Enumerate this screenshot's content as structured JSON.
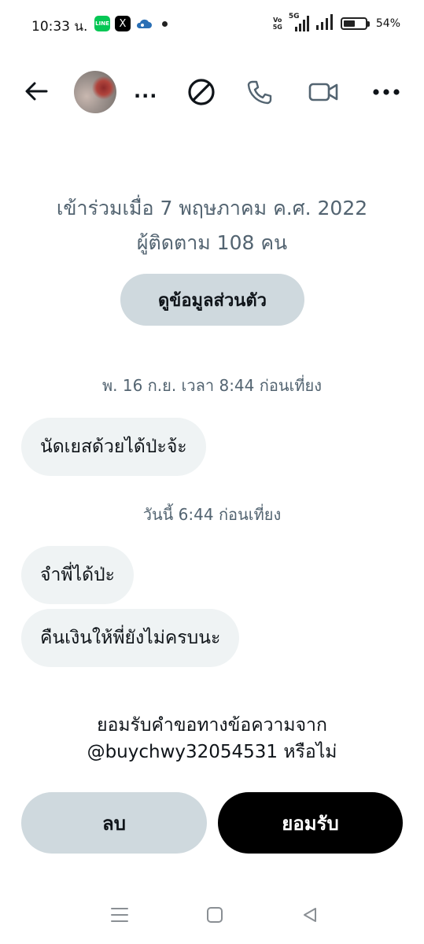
{
  "status_bar": {
    "time": "10:33 น.",
    "battery_percent": "54%",
    "battery_level": 0.54,
    "network": "5G",
    "volte": [
      "Vo",
      "5G"
    ],
    "apps": [
      "LINE",
      "X"
    ]
  },
  "header": {
    "name": "...",
    "icons": [
      "back-arrow-icon",
      "block-icon",
      "phone-icon",
      "video-icon",
      "more-icon"
    ]
  },
  "profile": {
    "joined": "เข้าร่วมเมื่อ 7 พฤษภาคม ค.ศ. 2022",
    "followers": "ผู้ติดตาม 108 คน",
    "view_profile_label": "ดูข้อมูลส่วนตัว"
  },
  "messages": {
    "timestamp_1": "พ. 16 ก.ย. เวลา 8:44 ก่อนเที่ยง",
    "message_1": "นัดเยสด้วยได้ป่ะจ้ะ",
    "timestamp_2": "วันนี้ 6:44 ก่อนเที่ยง",
    "message_2": "จำพี่ได้ป่ะ",
    "message_3": "คืนเงินให้พี่ยังไม่ครบนะ"
  },
  "request": {
    "prompt_line1": "ยอมรับคำขอทางข้อความจาก",
    "prompt_line2": "@buychwy32054531 หรือไม่",
    "delete_label": "ลบ",
    "accept_label": "ยอมรับ"
  },
  "colors": {
    "secondary_text": "#536471",
    "bubble_bg": "#eff3f4",
    "button_gray": "#cfd9de",
    "accept_bg": "#000000"
  }
}
